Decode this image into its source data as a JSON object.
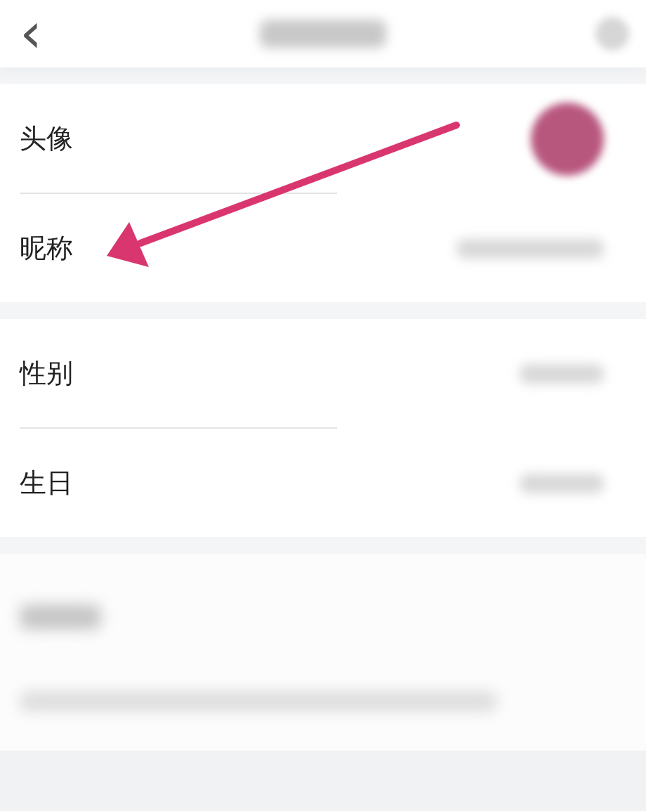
{
  "header": {
    "back": "‹"
  },
  "sections": [
    {
      "kind": "rows",
      "rows": [
        {
          "label": "头像",
          "kind": "avatar"
        },
        {
          "label": "昵称",
          "kind": "wide"
        }
      ]
    },
    {
      "kind": "rows",
      "rows": [
        {
          "label": "性别",
          "kind": "short"
        },
        {
          "label": "生日",
          "kind": "short"
        }
      ]
    },
    {
      "kind": "note"
    }
  ],
  "annotations": [
    {
      "kind": "arrow",
      "color": "#d9366f"
    }
  ]
}
